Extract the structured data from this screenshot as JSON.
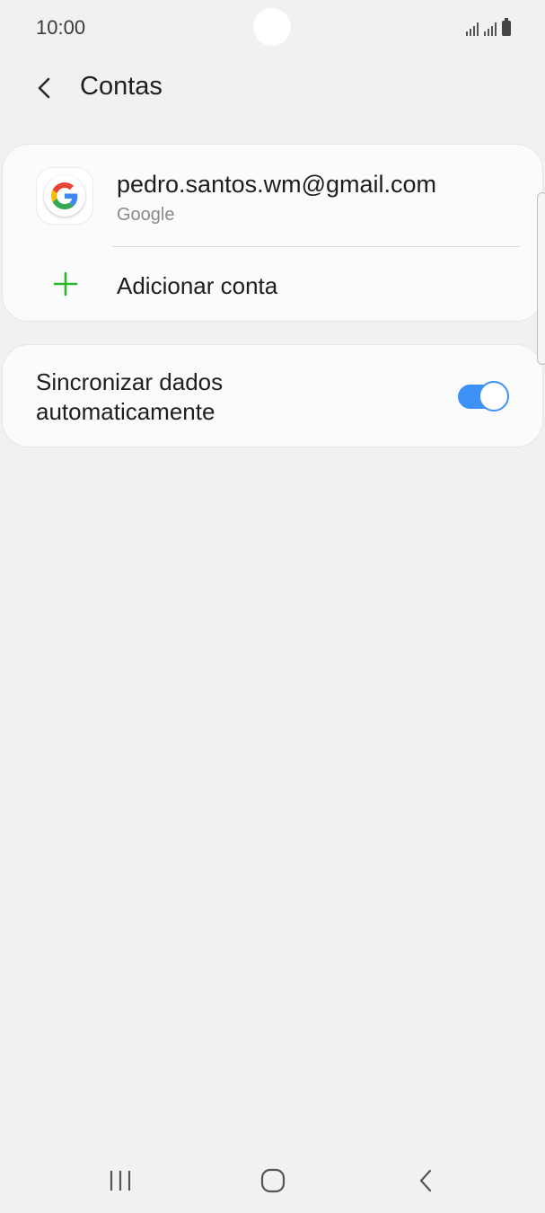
{
  "status_bar": {
    "time": "10:00"
  },
  "header": {
    "title": "Contas",
    "back_icon": "chevron-left-icon"
  },
  "accounts": [
    {
      "email": "pedro.santos.wm@gmail.com",
      "provider": "Google",
      "icon": "google-logo-icon"
    }
  ],
  "add_account": {
    "label": "Adicionar conta",
    "icon": "plus-icon",
    "icon_color": "#2db52d"
  },
  "sync": {
    "label": "Sincronizar dados automaticamente",
    "enabled": true,
    "toggle_color": "#3e91f7"
  },
  "nav_bar": {
    "recents_icon": "recents-icon",
    "home_icon": "home-icon",
    "back_icon": "back-icon"
  }
}
